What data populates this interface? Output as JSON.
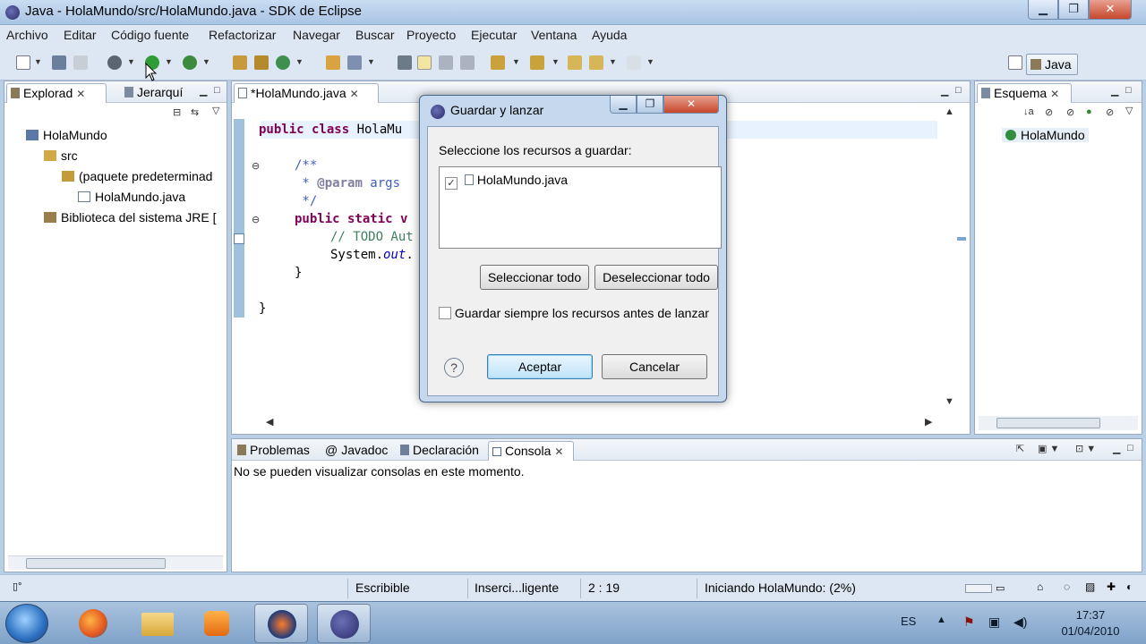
{
  "window": {
    "title": "Java - HolaMundo/src/HolaMundo.java - SDK de Eclipse",
    "minimize": "▁",
    "maximize": "❐",
    "close": "✕"
  },
  "menu": [
    "Archivo",
    "Editar",
    "Código fuente",
    "Refactorizar",
    "Navegar",
    "Buscar",
    "Proyecto",
    "Ejecutar",
    "Ventana",
    "Ayuda"
  ],
  "toolbar": {
    "perspective_label": "Java"
  },
  "explorer": {
    "tab1": "Explorad",
    "tab2": "Jerarquí",
    "items": [
      "HolaMundo",
      "src",
      "(paquete predeterminad",
      "HolaMundo.java",
      "Biblioteca del sistema JRE ["
    ]
  },
  "editor": {
    "tab": "*HolaMundo.java",
    "lines": {
      "l1_kw": "public class ",
      "l1_rest": "HolaMu",
      "l2": "/**",
      "l3_star": " * ",
      "l3_tag": "@param",
      "l3_rest": " args",
      "l4": " */",
      "l5_kw": "public static v",
      "l6": "// TODO Aut",
      "l7_a": "System.",
      "l7_b": "out",
      "l7_c": ".",
      "l8": "}",
      "l9": "}"
    }
  },
  "outline": {
    "tab": "Esquema",
    "item": "HolaMundo"
  },
  "bottom": {
    "tabs": [
      "Problemas",
      "Javadoc",
      "Declaración",
      "Consola"
    ],
    "message": "No se pueden visualizar consolas en este momento."
  },
  "status": {
    "writable": "Escribible",
    "insert": "Inserci...ligente",
    "position": "2 : 19",
    "progress_text": "Iniciando HolaMundo: (2%)"
  },
  "dialog": {
    "title": "Guardar y lanzar",
    "prompt": "Seleccione los recursos a guardar:",
    "resource": "HolaMundo.java",
    "resource_checked": true,
    "select_all": "Seleccionar todo",
    "deselect_all": "Deseleccionar todo",
    "always_save": "Guardar siempre los recursos antes de lanzar",
    "always_save_checked": false,
    "ok": "Aceptar",
    "cancel": "Cancelar"
  },
  "taskbar": {
    "lang": "ES",
    "time": "17:37",
    "date": "01/04/2010"
  },
  "colors": {
    "keyword": "#7f0055",
    "comment": "#3f7f5f",
    "javadoc": "#3f5fbf"
  }
}
